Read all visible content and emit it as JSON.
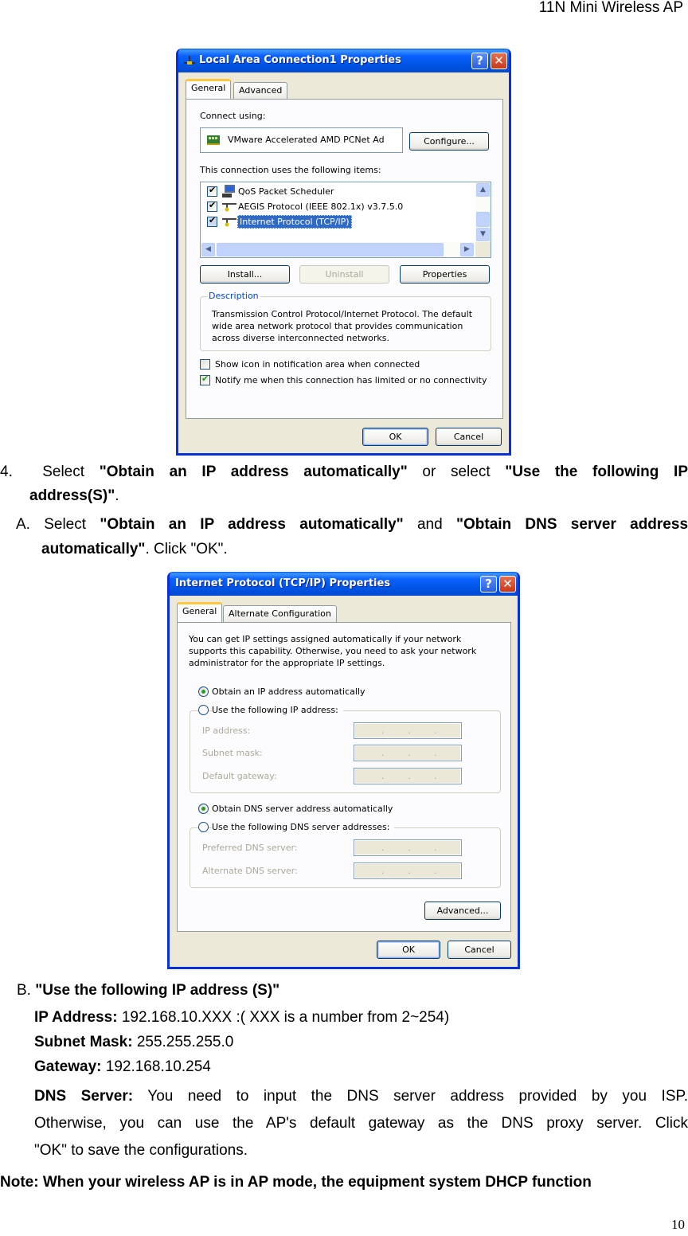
{
  "header": {
    "title": "11N Mini Wireless AP"
  },
  "dialog1": {
    "title": "Local Area Connection1 Properties",
    "help_label": "?",
    "close_label": "✕",
    "tabs": [
      {
        "label": "General",
        "active": true
      },
      {
        "label": "Advanced",
        "active": false
      }
    ],
    "connect_using_label": "Connect using:",
    "adapter_name": "VMware Accelerated AMD PCNet Ad",
    "configure_button": "Configure...",
    "items_label": "This connection uses the following items:",
    "items": [
      {
        "label": "QoS Packet Scheduler",
        "checked": true,
        "icon": "scheduler-icon"
      },
      {
        "label": "AEGIS Protocol (IEEE 802.1x) v3.7.5.0",
        "checked": true,
        "icon": "protocol-icon"
      },
      {
        "label": "Internet Protocol (TCP/IP)",
        "checked": true,
        "icon": "protocol-icon",
        "selected": true
      }
    ],
    "install_button": "Install...",
    "uninstall_button": "Uninstall",
    "properties_button": "Properties",
    "description_label": "Description",
    "description_text": "Transmission Control Protocol/Internet Protocol. The default wide area network protocol that provides communication across diverse interconnected networks.",
    "checkbox_show_icon": {
      "label": "Show icon in notification area when connected",
      "checked": false
    },
    "checkbox_notify": {
      "label": "Notify me when this connection has limited or no connectivity",
      "checked": true
    },
    "ok_button": "OK",
    "cancel_button": "Cancel"
  },
  "step4": {
    "number": "4.",
    "text_1": "Select",
    "bold_1": "\"Obtain an IP address automatically\"",
    "text_2": "or select",
    "bold_2": "\"Use the following IP address(S)\"",
    "text_3": "."
  },
  "stepA": {
    "prefix": "A. Select",
    "bold_1": "\"Obtain an IP address automatically\"",
    "text_2": "and",
    "bold_2": "\"Obtain DNS server address automatically\"",
    "text_3": ". Click \"OK\"."
  },
  "dialog2": {
    "title": "Internet Protocol (TCP/IP) Properties",
    "help_label": "?",
    "close_label": "✕",
    "tabs": [
      {
        "label": "General",
        "active": true
      },
      {
        "label": "Alternate Configuration",
        "active": false
      }
    ],
    "intro_text": "You can get IP settings assigned automatically if your network supports this capability. Otherwise, you need to ask your network administrator for the appropriate IP settings.",
    "radio_obtain_ip": {
      "label": "Obtain an IP address automatically",
      "selected": true
    },
    "radio_use_ip": {
      "label": "Use the following IP address:",
      "selected": false
    },
    "ip_fields": [
      {
        "label": "IP address:",
        "value": "  .   .   ."
      },
      {
        "label": "Subnet mask:",
        "value": "  .   .   ."
      },
      {
        "label": "Default gateway:",
        "value": "  .   .   ."
      }
    ],
    "radio_obtain_dns": {
      "label": "Obtain DNS server address automatically",
      "selected": true
    },
    "radio_use_dns": {
      "label": "Use the following DNS server addresses:",
      "selected": false
    },
    "dns_fields": [
      {
        "label": "Preferred DNS server:",
        "value": ""
      },
      {
        "label": "Alternate DNS server:",
        "value": ""
      }
    ],
    "advanced_button": "Advanced...",
    "ok_button": "OK",
    "cancel_button": "Cancel"
  },
  "stepB": {
    "heading_prefix": "B.",
    "heading": "\"Use the following IP address (S)\"",
    "ip_label": "IP Address:",
    "ip_value": "192.168.10.XXX :( XXX is a number from 2~254)",
    "mask_label": "Subnet Mask:",
    "mask_value": "255.255.255.0",
    "gateway_label": "Gateway:",
    "gateway_value": "192.168.10.254",
    "dns_label": "DNS Server:",
    "dns_line1": "You need to input the DNS server address provided by you ISP.",
    "dns_line2": "Otherwise, you can use the AP's default gateway as the DNS proxy server. Click",
    "dns_line3": "\"OK\" to save the configurations."
  },
  "note": {
    "text": "Note: When your wireless AP is in AP mode, the equipment system DHCP function"
  },
  "footer": {
    "page_number": "10"
  }
}
